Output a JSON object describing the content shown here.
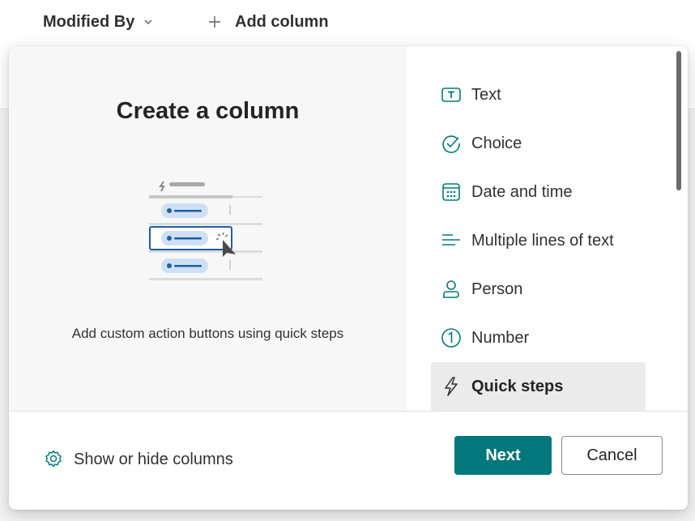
{
  "header": {
    "modified_by": "Modified By",
    "add_column": "Add column"
  },
  "dialog": {
    "title": "Create a column",
    "caption": "Add custom action buttons using quick steps",
    "types": [
      {
        "label": "Text",
        "icon": "text-box-icon"
      },
      {
        "label": "Choice",
        "icon": "checkmark-circle-icon"
      },
      {
        "label": "Date and time",
        "icon": "calendar-icon"
      },
      {
        "label": "Multiple lines of text",
        "icon": "text-lines-icon"
      },
      {
        "label": "Person",
        "icon": "person-icon"
      },
      {
        "label": "Number",
        "icon": "number-circle-icon"
      },
      {
        "label": "Quick steps",
        "icon": "flash-icon",
        "selected": true
      }
    ],
    "footer": {
      "show_hide": "Show or hide columns",
      "next": "Next",
      "cancel": "Cancel"
    }
  },
  "colors": {
    "accent": "#03787c",
    "selected_bg": "#ebebeb",
    "illustration_blue": "#1a5fa8",
    "illustration_pill": "#cfe0f5"
  }
}
